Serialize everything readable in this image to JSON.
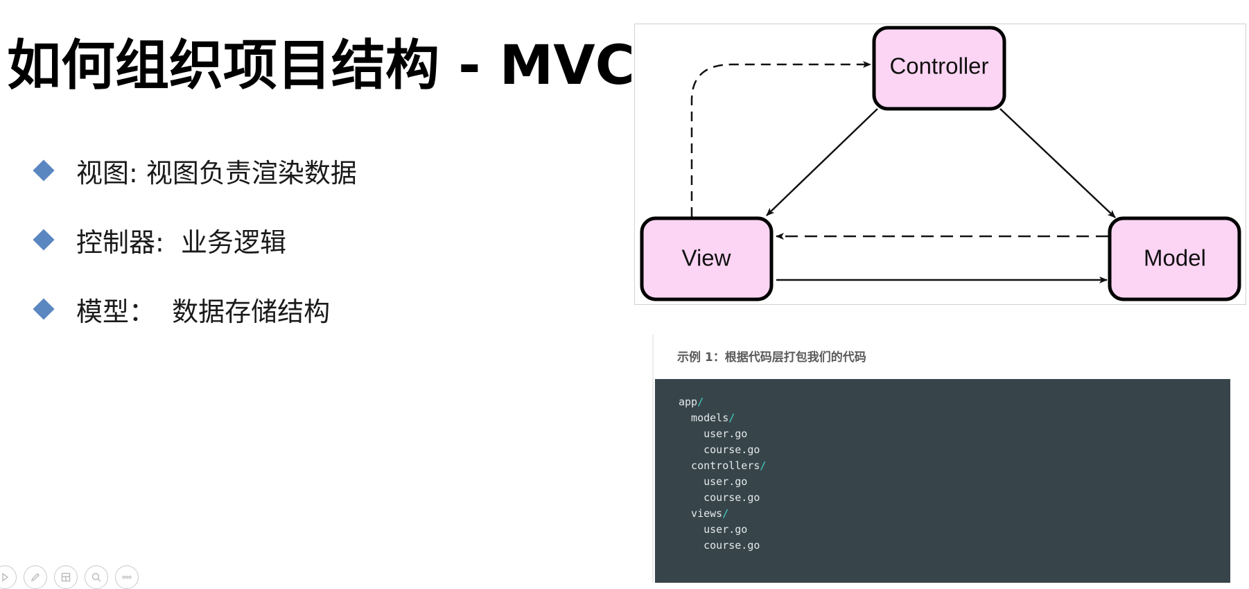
{
  "slide": {
    "title": "如何组织项目结构 - MVC",
    "bullets": [
      "视图: 视图负责渲染数据",
      "控制器:  业务逻辑",
      "模型：  数据存储结构"
    ]
  },
  "diagram": {
    "nodes": {
      "controller": "Controller",
      "view": "View",
      "model": "Model"
    },
    "node_fill": "#fdd5f4",
    "node_stroke": "#000000"
  },
  "example": {
    "caption": "示例 1：根据代码层打包我们的代码",
    "code_lines": [
      {
        "name": "app",
        "slash": "/"
      },
      {
        "name": "  models",
        "slash": "/"
      },
      {
        "name": "    user.go",
        "slash": ""
      },
      {
        "name": "    course.go",
        "slash": ""
      },
      {
        "name": "  controllers",
        "slash": "/"
      },
      {
        "name": "    user.go",
        "slash": ""
      },
      {
        "name": "    course.go",
        "slash": ""
      },
      {
        "name": "  views",
        "slash": "/"
      },
      {
        "name": "    user.go",
        "slash": ""
      },
      {
        "name": "    course.go",
        "slash": ""
      }
    ],
    "code_bg": "#37444a",
    "slash_color": "#3fd1c4"
  },
  "toolbar": {
    "buttons": [
      "play-icon",
      "pen-icon",
      "slides-grid-icon",
      "zoom-icon",
      "more-icon"
    ]
  }
}
